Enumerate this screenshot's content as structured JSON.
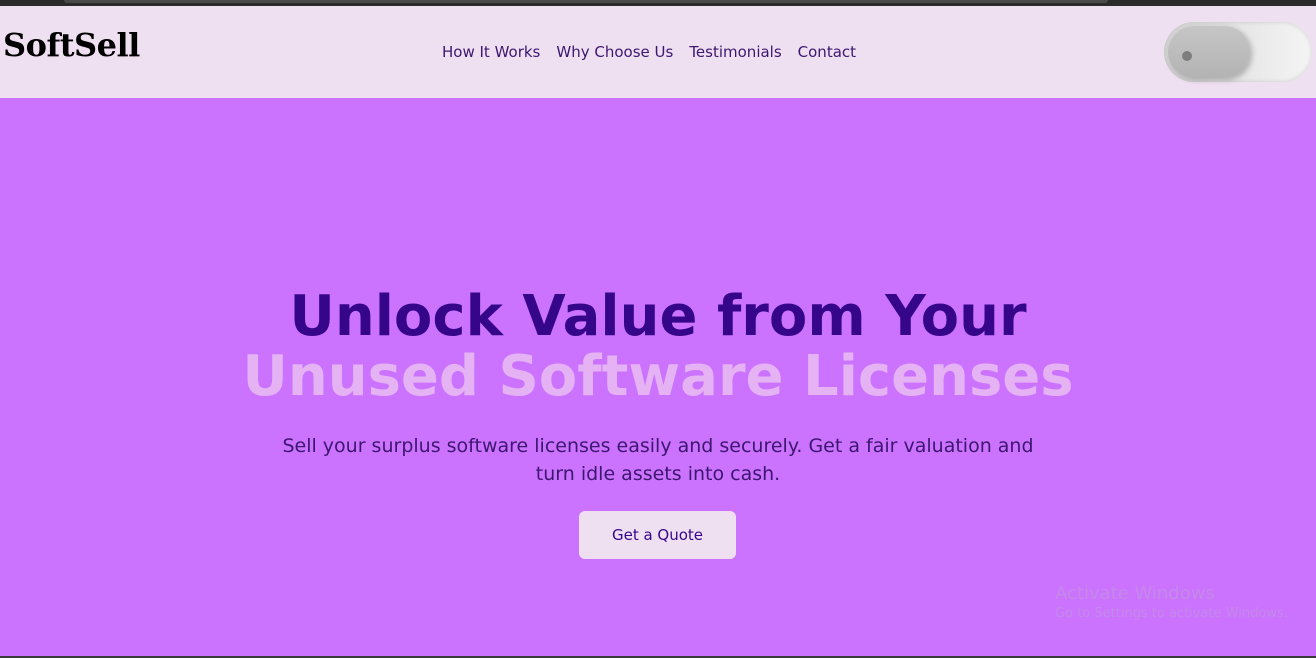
{
  "brand": {
    "logo_text": "SoftSell"
  },
  "nav": {
    "links": [
      {
        "label": "How It Works"
      },
      {
        "label": "Why Choose Us"
      },
      {
        "label": "Testimonials"
      },
      {
        "label": "Contact"
      }
    ]
  },
  "theme_toggle": {
    "state": "off"
  },
  "hero": {
    "title_line1": "Unlock Value from Your",
    "title_line2": "Unused Software Licenses",
    "subtitle": "Sell your surplus software licenses easily and securely. Get a fair valuation and turn idle assets into cash.",
    "cta_label": "Get a Quote"
  },
  "watermark": {
    "title": "Activate Windows",
    "subtitle": "Go to Settings to activate Windows."
  },
  "colors": {
    "navbar_bg": "#efe0f1",
    "hero_bg": "#cb72fe",
    "title_dark": "#35058a",
    "title_light": "#e5b2f4",
    "text": "#3d1670"
  }
}
